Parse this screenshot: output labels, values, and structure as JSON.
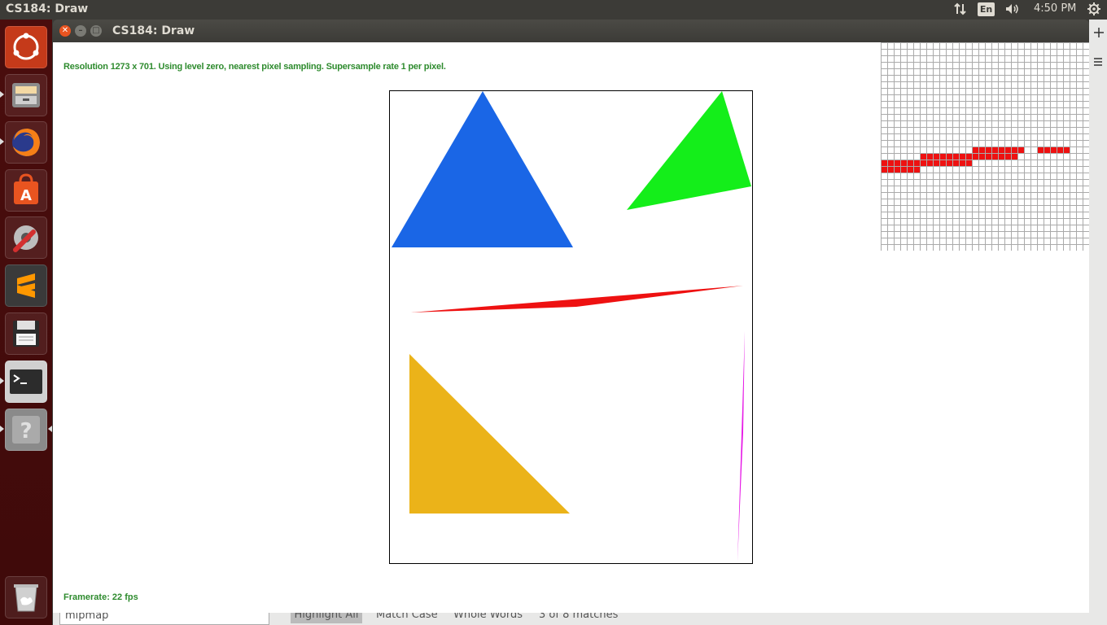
{
  "topbar": {
    "title": "CS184: Draw",
    "lang": "En",
    "time": "4:50 PM",
    "icons": [
      "network-icon",
      "keyboard-language-icon",
      "volume-icon",
      "settings-gear-icon"
    ]
  },
  "launcher": {
    "items": [
      {
        "name": "ubuntu-dash-icon",
        "color": "#e95420"
      },
      {
        "name": "files-icon",
        "color": "#8a8a8a"
      },
      {
        "name": "firefox-icon",
        "color": "#e66000"
      },
      {
        "name": "software-center-icon",
        "color": "#e95420"
      },
      {
        "name": "system-settings-icon",
        "color": "#666666"
      },
      {
        "name": "sublime-text-icon",
        "color": "#ff9800"
      },
      {
        "name": "save-disk-icon",
        "color": "#555555"
      },
      {
        "name": "terminal-icon",
        "color": "#2c2c2c"
      },
      {
        "name": "help-icon",
        "color": "#777777"
      },
      {
        "name": "trash-icon",
        "color": "#999999"
      }
    ]
  },
  "window": {
    "title": "CS184: Draw",
    "status_top": "Resolution 1273 x 701. Using level zero, nearest pixel sampling. Supersample rate 1 per pixel.",
    "status_bottom": "Framerate: 22 fps"
  },
  "scene": {
    "shapes": [
      {
        "name": "blue-triangle",
        "color": "#1a66e6"
      },
      {
        "name": "green-triangle",
        "color": "#14ee1a"
      },
      {
        "name": "red-thin-triangle",
        "color": "#ee1111"
      },
      {
        "name": "yellow-triangle",
        "color": "#ebb319"
      },
      {
        "name": "magenta-thin-triangle",
        "color": "#e61ae6"
      }
    ]
  },
  "behind": {
    "search_value": "mipmap",
    "highlight": "Highlight All",
    "match_case": "Match Case",
    "whole_words": "Whole Words",
    "matches": "3 of 8 matches"
  }
}
